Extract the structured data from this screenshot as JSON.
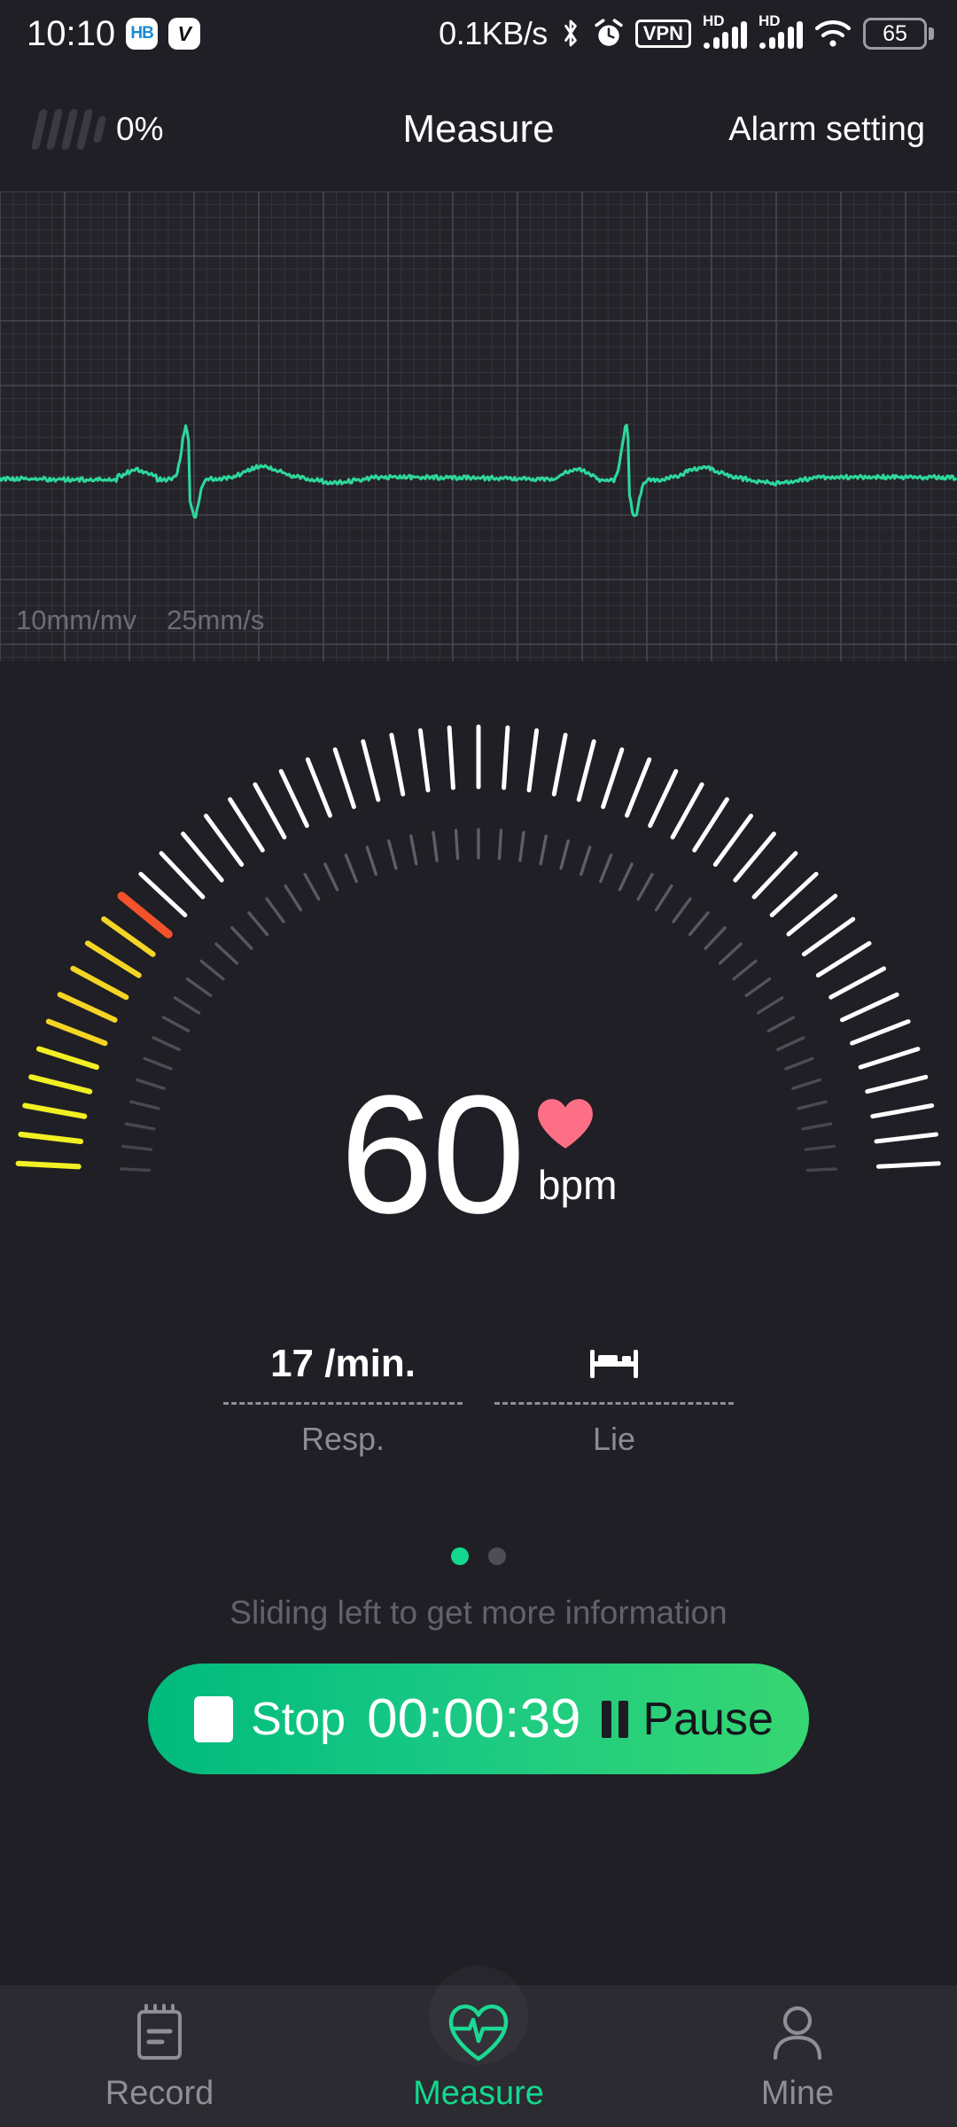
{
  "statusbar": {
    "clock": "10:10",
    "app_icons": [
      {
        "name": "hb-app-icon",
        "text": "HB"
      },
      {
        "name": "v-app-icon",
        "text": "V"
      }
    ],
    "netspeed": "0.1KB/s",
    "bluetooth_icon": "bluetooth-icon",
    "alarm_icon": "alarm-icon",
    "vpn_label": "VPN",
    "signal_hd_label": "HD",
    "wifi_icon": "wifi-icon",
    "battery_level": "65"
  },
  "header": {
    "signal_percent": "0%",
    "title": "Measure",
    "alarm_setting": "Alarm setting"
  },
  "ecg": {
    "scale_amplitude": "10mm/mv",
    "scale_speed": "25mm/s",
    "trace_color": "#2ed79b",
    "grid_color": "#3b3b43",
    "background": "#232329"
  },
  "measure": {
    "bpm_value": "60",
    "bpm_unit": "bpm",
    "heart_color": "#fc6f86",
    "stats": [
      {
        "name": "resp",
        "value": "17 /min.",
        "label": "Resp.",
        "icon": null
      },
      {
        "name": "posture",
        "value": null,
        "label": "Lie",
        "icon": "bed-icon"
      }
    ],
    "pager": {
      "total": 2,
      "active_index": 0,
      "active_color": "#13d88e"
    },
    "hint": "Sliding left to get more information",
    "controls": {
      "stop_label": "Stop",
      "timer": "00:00:39",
      "pause_label": "Pause",
      "accent_start": "#00ba7c",
      "accent_end": "#37d672"
    }
  },
  "bottom_nav": {
    "items": [
      {
        "label": "Record",
        "icon": "clipboard-icon",
        "active": false
      },
      {
        "label": "Measure",
        "icon": "heart-pulse-icon",
        "active": true
      },
      {
        "label": "Mine",
        "icon": "person-icon",
        "active": false
      }
    ]
  },
  "chart_data": {
    "type": "line",
    "title": "ECG waveform",
    "xlabel": "25mm/s",
    "ylabel": "10mm/mv",
    "grid": true,
    "series": [
      {
        "name": "ECG Lead",
        "beats": 2,
        "heart_rate_bpm": 60,
        "respiration_per_min": 17,
        "r_peak_x": [
          0.195,
          0.655
        ],
        "baseline_y": 0.615
      }
    ]
  }
}
